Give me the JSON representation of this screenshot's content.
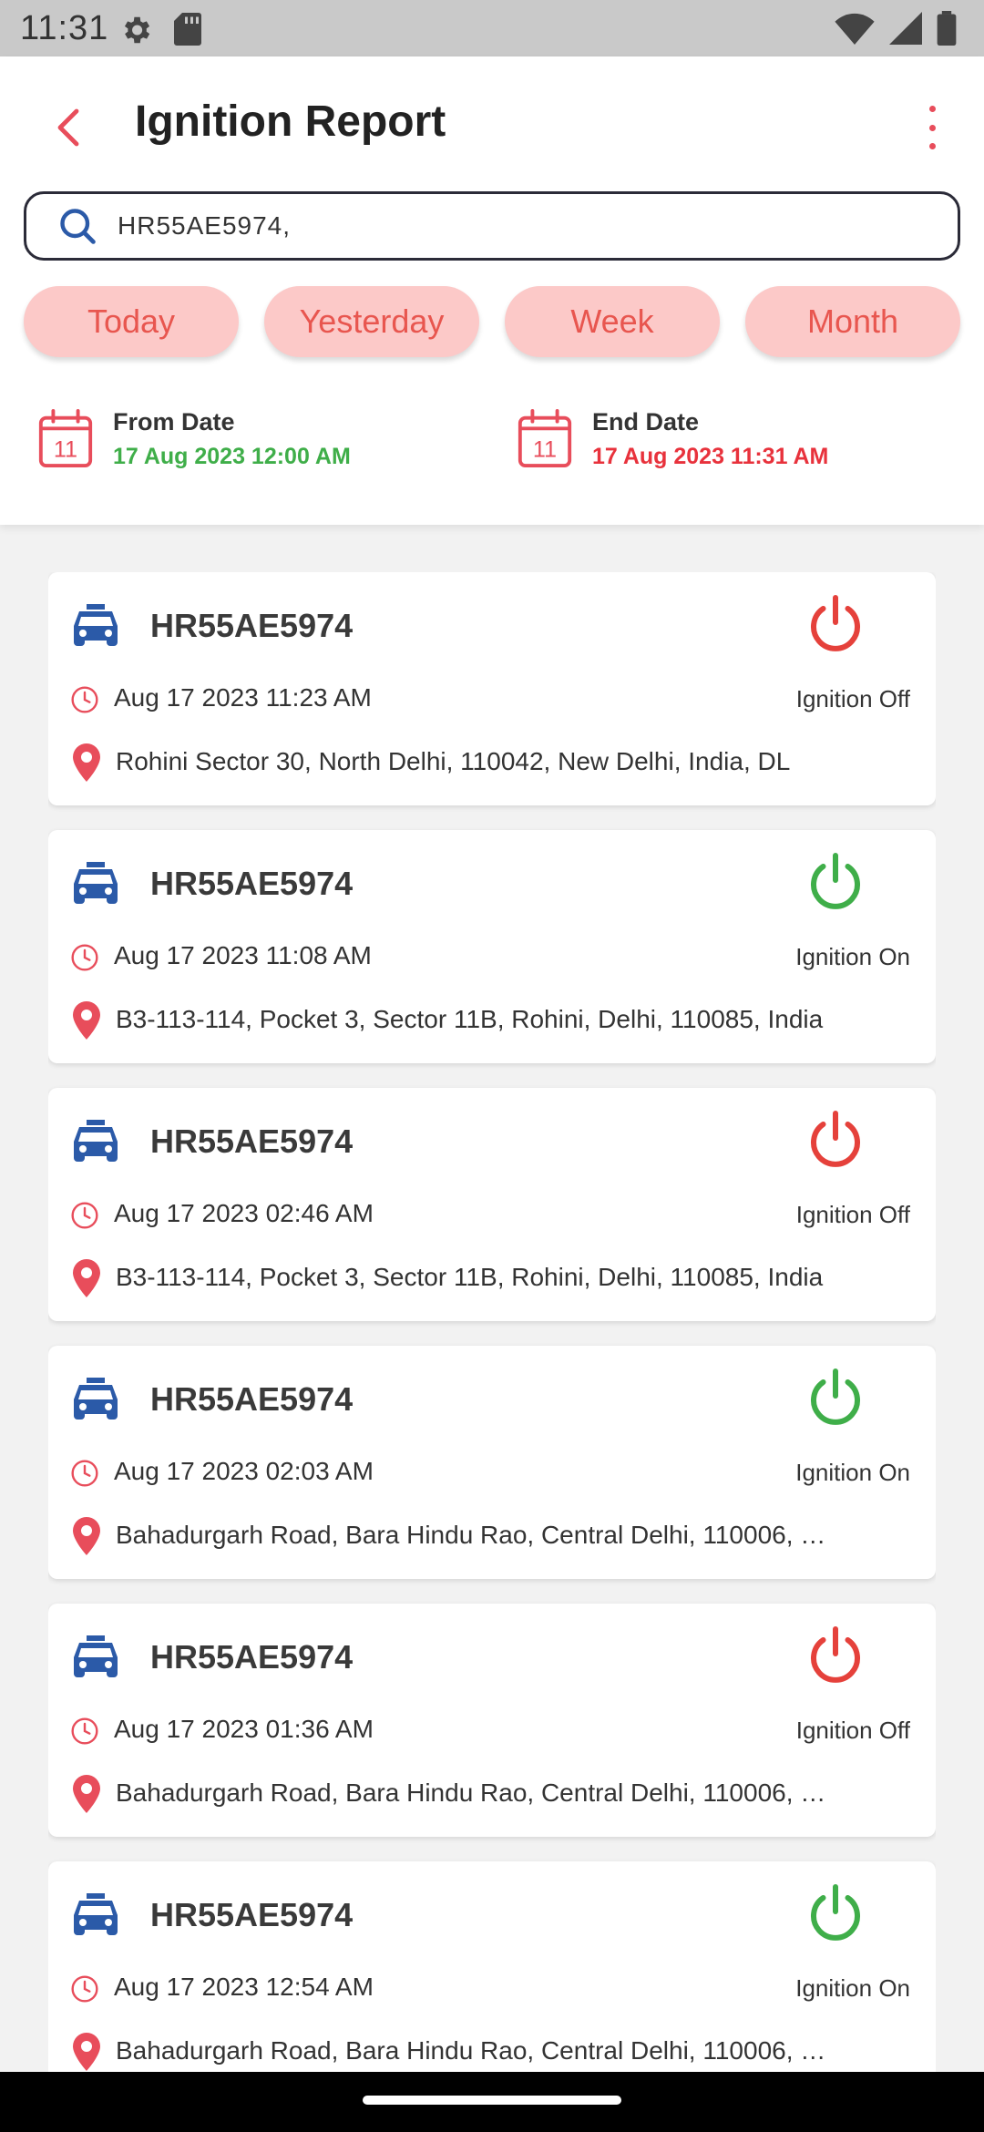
{
  "status_bar": {
    "time": "11:31"
  },
  "header": {
    "title": "Ignition Report"
  },
  "search": {
    "value": "HR55AE5974,"
  },
  "filters": [
    {
      "label": "Today"
    },
    {
      "label": "Yesterday"
    },
    {
      "label": "Week"
    },
    {
      "label": "Month"
    }
  ],
  "dates": {
    "from_label": "From Date",
    "from_value": "17 Aug 2023 12:00 AM",
    "end_label": "End Date",
    "end_value": "17 Aug 2023 11:31 AM",
    "calendar_day": "11"
  },
  "colors": {
    "accent": "#e84d5b",
    "chip_bg": "#fcc9c8",
    "ignition_on": "#3fae49",
    "ignition_off": "#e5413b",
    "from_date": "#3fae49",
    "end_date": "#e8323c",
    "car_icon": "#2b5aa8"
  },
  "reports": [
    {
      "vehicle": "HR55AE5974",
      "time": "Aug 17 2023 11:23 AM",
      "status": "Ignition Off",
      "state": "off",
      "address": "Rohini Sector 30, North Delhi, 110042, New Delhi, India, DL"
    },
    {
      "vehicle": "HR55AE5974",
      "time": "Aug 17 2023 11:08 AM",
      "status": "Ignition On",
      "state": "on",
      "address": "B3-113-114, Pocket 3, Sector 11B, Rohini, Delhi, 110085, India"
    },
    {
      "vehicle": "HR55AE5974",
      "time": "Aug 17 2023 02:46 AM",
      "status": "Ignition Off",
      "state": "off",
      "address": "B3-113-114, Pocket 3, Sector 11B, Rohini, Delhi, 110085, India"
    },
    {
      "vehicle": "HR55AE5974",
      "time": "Aug 17 2023 02:03 AM",
      "status": "Ignition On",
      "state": "on",
      "address": "Bahadurgarh Road, Bara Hindu Rao, Central Delhi, 110006, …"
    },
    {
      "vehicle": "HR55AE5974",
      "time": "Aug 17 2023 01:36 AM",
      "status": "Ignition Off",
      "state": "off",
      "address": "Bahadurgarh Road, Bara Hindu Rao, Central Delhi, 110006, …"
    },
    {
      "vehicle": "HR55AE5974",
      "time": "Aug 17 2023 12:54 AM",
      "status": "Ignition On",
      "state": "on",
      "address": "Bahadurgarh Road, Bara Hindu Rao, Central Delhi, 110006, …"
    }
  ]
}
